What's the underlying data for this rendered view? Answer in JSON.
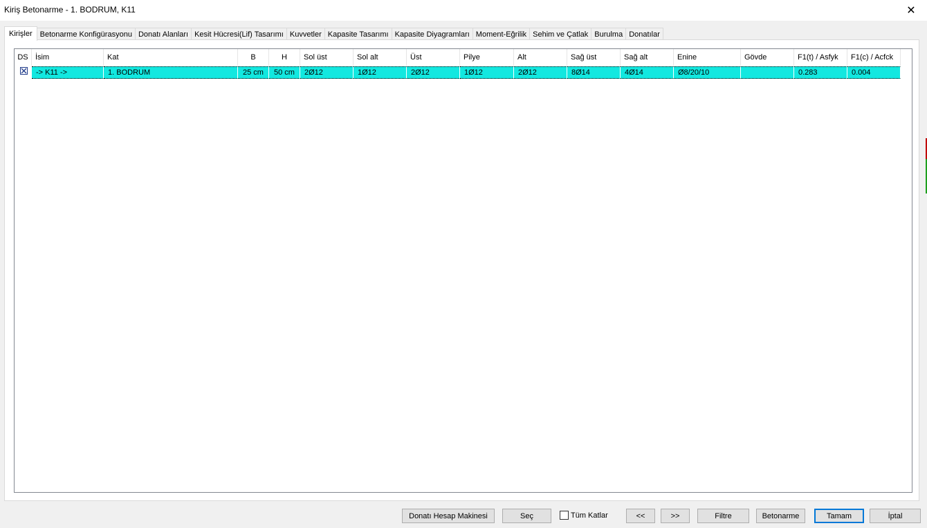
{
  "window": {
    "title": "Kiriş Betonarme - 1. BODRUM, K11",
    "close_glyph": "✕"
  },
  "tabs": [
    {
      "label": "Kirişler"
    },
    {
      "label": "Betonarme Konfigürasyonu"
    },
    {
      "label": "Donatı Alanları"
    },
    {
      "label": "Kesit Hücresi(Lif) Tasarımı"
    },
    {
      "label": "Kuvvetler"
    },
    {
      "label": "Kapasite Tasarımı"
    },
    {
      "label": "Kapasite Diyagramları"
    },
    {
      "label": "Moment-Eğrilik"
    },
    {
      "label": "Sehim ve Çatlak"
    },
    {
      "label": "Burulma"
    },
    {
      "label": "Donatılar"
    }
  ],
  "grid": {
    "columns": [
      "DS",
      "İsim",
      "Kat",
      "B",
      "H",
      "Sol üst",
      "Sol alt",
      "Üst",
      "Pilye",
      "Alt",
      "Sağ üst",
      "Sağ alt",
      "Enine",
      "Gövde",
      "F1(t) / Asfyk",
      "F1(c) / Acfck"
    ],
    "rows": [
      {
        "ds_checked": true,
        "isim": "-> K11 ->",
        "kat": "1. BODRUM",
        "b": "25 cm",
        "h": "50 cm",
        "sol_ust": "2Ø12",
        "sol_alt": "1Ø12",
        "ust": "2Ø12",
        "pilye": "1Ø12",
        "alt": "2Ø12",
        "sag_ust": "8Ø14",
        "sag_alt": "4Ø14",
        "enine": "Ø8/20/10",
        "govde": "",
        "f1t": "0.283",
        "f1c": "0.004"
      }
    ],
    "selection_color": "#12e8e0"
  },
  "footer": {
    "calc_button": "Donatı Hesap Makinesi",
    "select_button": "Seç",
    "all_floors_label": "Tüm Katlar",
    "prev_button": "<<",
    "next_button": ">>",
    "filter_button": "Filtre",
    "concrete_button": "Betonarme",
    "ok_button": "Tamam",
    "cancel_button": "İptal"
  }
}
